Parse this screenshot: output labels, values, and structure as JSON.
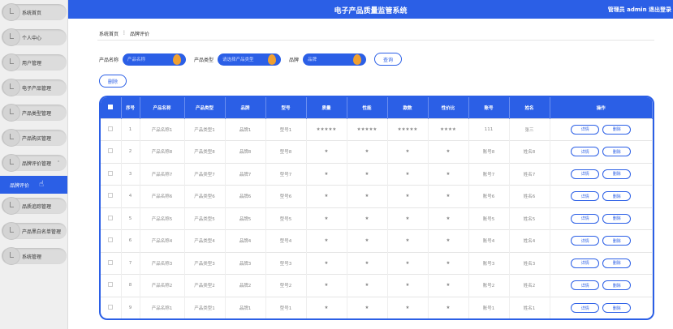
{
  "header": {
    "title": "电子产品质量监管系统",
    "user": "管理员 admin  退出登录"
  },
  "sidebar": {
    "items": [
      {
        "label": "系统首页"
      },
      {
        "label": "个人中心"
      },
      {
        "label": "用户管理"
      },
      {
        "label": "电子产品管理"
      },
      {
        "label": "产品类型管理"
      },
      {
        "label": "产品购买管理"
      },
      {
        "label": "品牌评价管理",
        "expanded": true,
        "caret": "⌃"
      }
    ],
    "sub_active": "品牌评价",
    "items_after": [
      {
        "label": "品质追踪管理"
      },
      {
        "label": "产品黑白名单管理"
      },
      {
        "label": "系统管理"
      }
    ]
  },
  "breadcrumb": {
    "home": "系统首页",
    "sep": "⋮",
    "current": "品牌评价"
  },
  "search": {
    "f1_label": "产品名称",
    "f1_placeholder": "产品名称",
    "f2_label": "产品类型",
    "f2_placeholder": "请选择产品类型",
    "f3_label": "品牌",
    "f3_placeholder": "品牌",
    "query": "查询"
  },
  "delete_button": "删除",
  "table": {
    "headers": [
      "序号",
      "产品名称",
      "产品类型",
      "品牌",
      "型号",
      "质量",
      "性能",
      "款数",
      "性价比",
      "账号",
      "姓名",
      "操作"
    ],
    "detail": "详情",
    "delete": "删除",
    "rows": [
      [
        "1",
        "产品名称1",
        "产品类型1",
        "品牌1",
        "型号1",
        "★★★★★",
        "★★★★★",
        "★★★★★",
        "★★★★",
        "111",
        "张三"
      ],
      [
        "2",
        "产品名称8",
        "产品类型8",
        "品牌8",
        "型号8",
        "★",
        "★",
        "★",
        "★",
        "账号8",
        "姓名8"
      ],
      [
        "3",
        "产品名称7",
        "产品类型7",
        "品牌7",
        "型号7",
        "★",
        "★",
        "★",
        "★",
        "账号7",
        "姓名7"
      ],
      [
        "4",
        "产品名称6",
        "产品类型6",
        "品牌6",
        "型号6",
        "★",
        "★",
        "★",
        "★",
        "账号6",
        "姓名6"
      ],
      [
        "5",
        "产品名称5",
        "产品类型5",
        "品牌5",
        "型号5",
        "★",
        "★",
        "★",
        "★",
        "账号5",
        "姓名5"
      ],
      [
        "6",
        "产品名称4",
        "产品类型4",
        "品牌4",
        "型号4",
        "★",
        "★",
        "★",
        "★",
        "账号4",
        "姓名4"
      ],
      [
        "7",
        "产品名称3",
        "产品类型3",
        "品牌3",
        "型号3",
        "★",
        "★",
        "★",
        "★",
        "账号3",
        "姓名3"
      ],
      [
        "8",
        "产品名称2",
        "产品类型2",
        "品牌2",
        "型号2",
        "★",
        "★",
        "★",
        "★",
        "账号2",
        "姓名2"
      ],
      [
        "9",
        "产品名称1",
        "产品类型1",
        "品牌1",
        "型号1",
        "★",
        "★",
        "★",
        "★",
        "账号1",
        "姓名1"
      ]
    ]
  },
  "colors": {
    "primary": "#2b5fe6",
    "accent": "#f0a030"
  }
}
